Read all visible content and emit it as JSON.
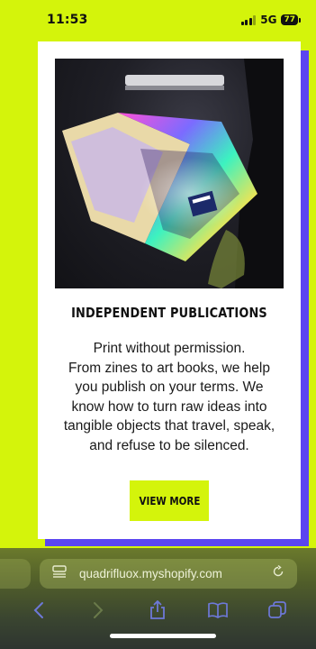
{
  "status_bar": {
    "time": "11:53",
    "network": "5G",
    "battery": "77"
  },
  "card": {
    "image_alt": "Person holding an open holographic zine in a dark room",
    "title": "INDEPENDENT PUBLICATIONS",
    "body_lines": [
      "Print without permission.",
      "From zines to art books, we help",
      "you publish on your terms. We",
      "know how to turn raw ideas into",
      "tangible objects that travel, speak,",
      "and refuse to be silenced."
    ],
    "cta_label": "VIEW MORE"
  },
  "browser": {
    "url": "quadrifluox.myshopify.com",
    "toolbar_icons": [
      "back-icon",
      "forward-icon",
      "share-icon",
      "bookmarks-icon",
      "tabs-icon"
    ]
  },
  "colors": {
    "background": "#d4f40b",
    "card_shadow": "#5b45f0",
    "card": "#ffffff",
    "cta_background": "#d4f40b"
  }
}
